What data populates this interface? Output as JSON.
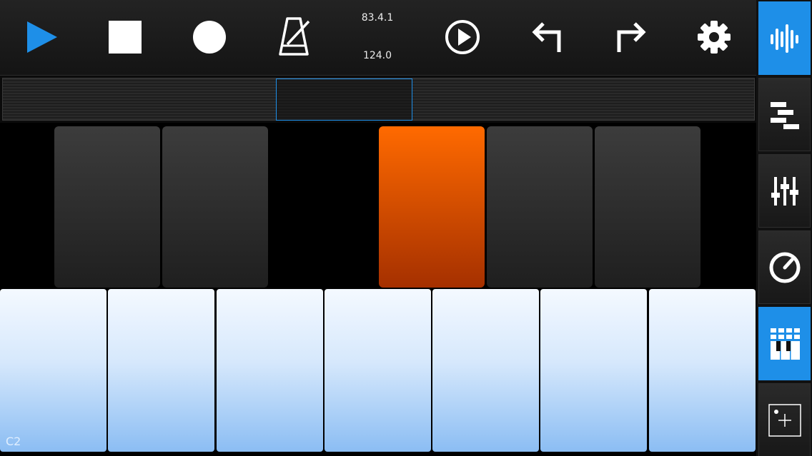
{
  "toolbar": {
    "position": "83.4.1",
    "tempo": "124.0",
    "buttons": [
      "play-icon",
      "stop-icon",
      "record-icon",
      "metronome-icon",
      "play-circle-icon",
      "undo-icon",
      "redo-icon",
      "gear-icon"
    ]
  },
  "keyboard": {
    "octave_label": "C2",
    "active_black_key": 4
  },
  "sidebar": {
    "items": [
      {
        "icon": "waveform-icon",
        "active": true
      },
      {
        "icon": "sequencer-icon",
        "active": false
      },
      {
        "icon": "mixer-icon",
        "active": false
      },
      {
        "icon": "knob-icon",
        "active": false
      },
      {
        "icon": "keyboard-grid-icon",
        "active": true
      },
      {
        "icon": "add-track-icon",
        "active": false
      }
    ]
  },
  "colors": {
    "accent": "#1e8fe8",
    "active_key": "#ff6a00"
  }
}
